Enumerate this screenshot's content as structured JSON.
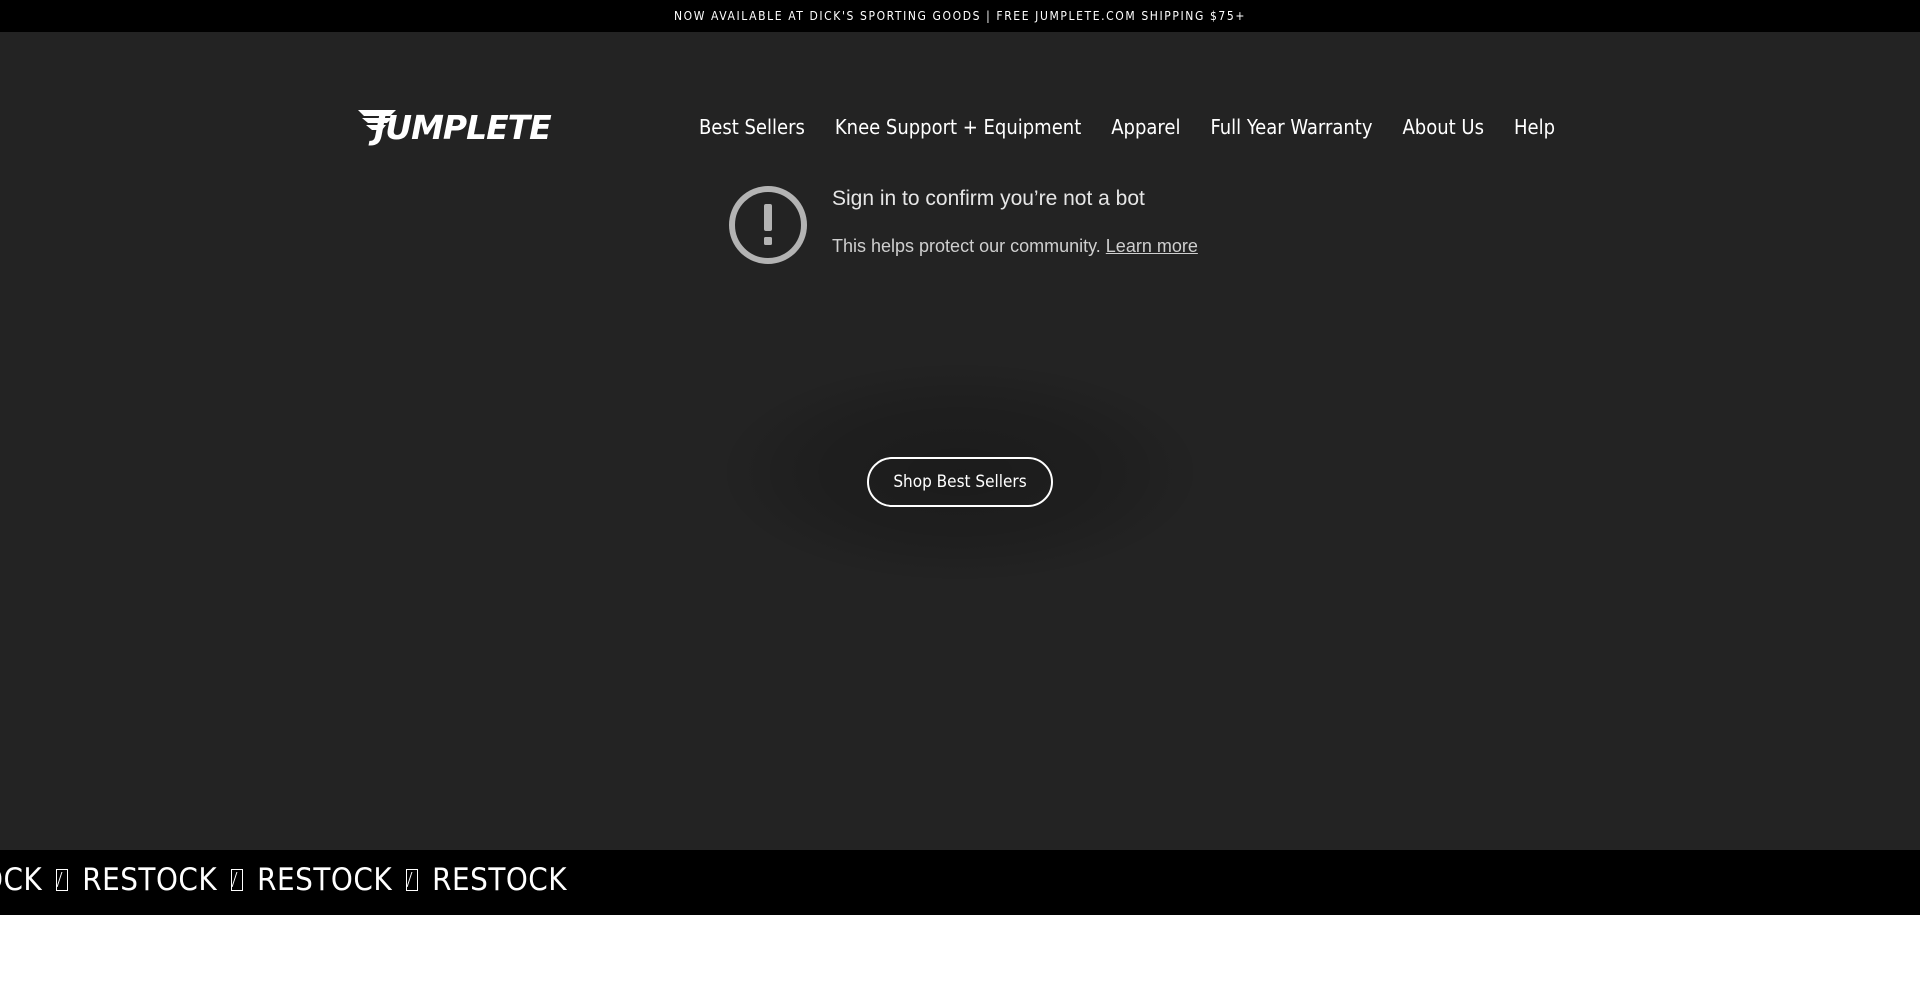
{
  "announcement": {
    "text": "NOW AVAILABLE AT DICK'S SPORTING GOODS | FREE JUMPLETE.COM SHIPPING $75+"
  },
  "header": {
    "logo_text": "JUMPLETE",
    "nav": [
      {
        "label": "Best Sellers"
      },
      {
        "label": "Knee Support + Equipment"
      },
      {
        "label": "Apparel"
      },
      {
        "label": "Full Year Warranty"
      },
      {
        "label": "About Us"
      },
      {
        "label": "Help"
      }
    ]
  },
  "notice": {
    "icon": "exclamation-circle-icon",
    "title": "Sign in to confirm you’re not a bot",
    "text": "This helps protect our community.",
    "link": "Learn more"
  },
  "hero": {
    "cta_label": "Shop Best Sellers"
  },
  "marquee": {
    "items": [
      "OCK",
      "RESTOCK",
      "RESTOCK",
      "RESTOCK"
    ]
  },
  "colors": {
    "hero_bg": "#232323",
    "bar_bg": "#000000",
    "text": "#ffffff"
  }
}
